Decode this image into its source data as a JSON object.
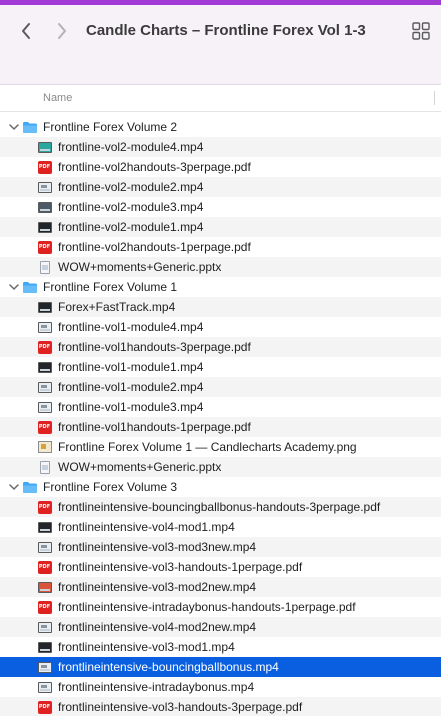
{
  "window": {
    "title": "Candle Charts – Frontline Forex Vol 1-3",
    "back_icon": "chevron-left-icon",
    "forward_icon": "chevron-right-icon",
    "view_icon": "grid-view-icon"
  },
  "columns": {
    "name": "Name"
  },
  "colors": {
    "accent": "#0a5fe0",
    "folder": "#3fa9f5",
    "pdf": "#e02121",
    "toolbar": "#f7f1f8"
  },
  "rows": [
    {
      "type": "folder",
      "name": "Frontline Forex Volume 2",
      "expanded": true,
      "icon": "folder-icon"
    },
    {
      "type": "file",
      "name": "frontline-vol2-module4.mp4",
      "icon": "video-icon",
      "variant": "teal"
    },
    {
      "type": "file",
      "name": "frontline-vol2handouts-3perpage.pdf",
      "icon": "pdf-icon"
    },
    {
      "type": "file",
      "name": "frontline-vol2-module2.mp4",
      "icon": "video-icon",
      "variant": "light"
    },
    {
      "type": "file",
      "name": "frontline-vol2-module3.mp4",
      "icon": "video-icon",
      "variant": ""
    },
    {
      "type": "file",
      "name": "frontline-vol2-module1.mp4",
      "icon": "video-icon",
      "variant": "dark"
    },
    {
      "type": "file",
      "name": "frontline-vol2handouts-1perpage.pdf",
      "icon": "pdf-icon"
    },
    {
      "type": "file",
      "name": "WOW+moments+Generic.pptx",
      "icon": "pptx-icon"
    },
    {
      "type": "folder",
      "name": "Frontline Forex Volume 1",
      "expanded": true,
      "icon": "folder-icon"
    },
    {
      "type": "file",
      "name": "Forex+FastTrack.mp4",
      "icon": "video-icon",
      "variant": "dark"
    },
    {
      "type": "file",
      "name": "frontline-vol1-module4.mp4",
      "icon": "video-icon",
      "variant": "light"
    },
    {
      "type": "file",
      "name": "frontline-vol1handouts-3perpage.pdf",
      "icon": "pdf-icon"
    },
    {
      "type": "file",
      "name": "frontline-vol1-module1.mp4",
      "icon": "video-icon",
      "variant": "dark"
    },
    {
      "type": "file",
      "name": "frontline-vol1-module2.mp4",
      "icon": "video-icon",
      "variant": "light"
    },
    {
      "type": "file",
      "name": "frontline-vol1-module3.mp4",
      "icon": "video-icon",
      "variant": "light"
    },
    {
      "type": "file",
      "name": "frontline-vol1handouts-1perpage.pdf",
      "icon": "pdf-icon"
    },
    {
      "type": "file",
      "name": "Frontline Forex  Volume 1 — Candlecharts Academy.png",
      "icon": "image-icon"
    },
    {
      "type": "file",
      "name": "WOW+moments+Generic.pptx",
      "icon": "pptx-icon"
    },
    {
      "type": "folder",
      "name": "Frontline Forex Volume 3",
      "expanded": true,
      "icon": "folder-icon"
    },
    {
      "type": "file",
      "name": "frontlineintensive-bouncingballbonus-handouts-3perpage.pdf",
      "icon": "pdf-icon"
    },
    {
      "type": "file",
      "name": "frontlineintensive-vol4-mod1.mp4",
      "icon": "video-icon",
      "variant": "dark"
    },
    {
      "type": "file",
      "name": "frontlineintensive-vol3-mod3new.mp4",
      "icon": "video-icon",
      "variant": "light"
    },
    {
      "type": "file",
      "name": "frontlineintensive-vol3-handouts-1perpage.pdf",
      "icon": "pdf-icon"
    },
    {
      "type": "file",
      "name": "frontlineintensive-vol3-mod2new.mp4",
      "icon": "video-icon",
      "variant": "warm"
    },
    {
      "type": "file",
      "name": "frontlineintensive-intradaybonus-handouts-1perpage.pdf",
      "icon": "pdf-icon"
    },
    {
      "type": "file",
      "name": "frontlineintensive-vol4-mod2new.mp4",
      "icon": "video-icon",
      "variant": "light"
    },
    {
      "type": "file",
      "name": "frontlineintensive-vol3-mod1.mp4",
      "icon": "video-icon",
      "variant": "dark"
    },
    {
      "type": "file",
      "name": "frontlineintensive-bouncingballbonus.mp4",
      "icon": "video-icon",
      "variant": "light",
      "selected": true
    },
    {
      "type": "file",
      "name": "frontlineintensive-intradaybonus.mp4",
      "icon": "video-icon",
      "variant": "light"
    },
    {
      "type": "file",
      "name": "frontlineintensive-vol3-handouts-3perpage.pdf",
      "icon": "pdf-icon"
    }
  ]
}
